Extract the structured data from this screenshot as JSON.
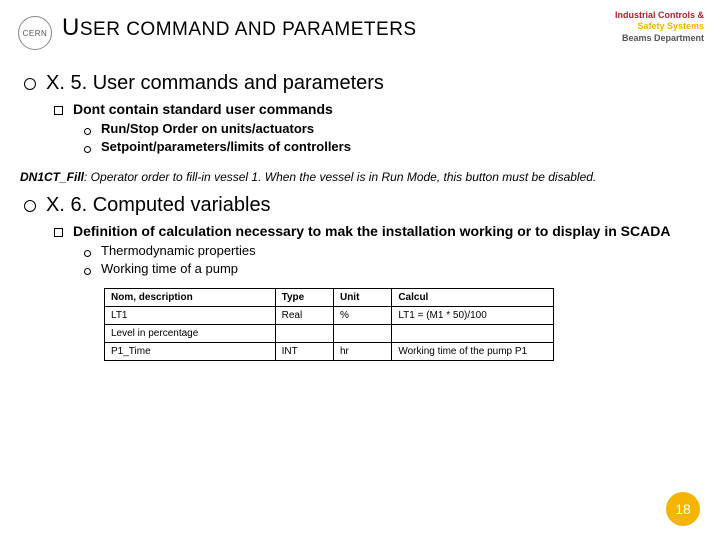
{
  "logo_text": "CERN",
  "dept": {
    "l1": "Industrial Controls &",
    "l2": "Safety Systems",
    "l3": "Beams Department"
  },
  "title_html": "U<span style='font-size:19px'>SER COMMAND AND PARAMETERS</span>",
  "sections": {
    "x5": {
      "heading": "X. 5. User commands and parameters",
      "sub1": "Dont contain standard user commands",
      "bul1": "Run/Stop Order on units/actuators",
      "bul2": "Setpoint/parameters/limits of controllers"
    },
    "note_key": "DN1CT_Fill",
    "note_text": ":  Operator order to fill-in vessel 1. When the vessel is in Run Mode, this button must be disabled.",
    "x6": {
      "heading": "X. 6. Computed variables",
      "sub1": "Definition of calculation necessary to mak the installation working or to display in SCADA",
      "bul1": "Thermodynamic properties",
      "bul2": "Working time of a pump"
    }
  },
  "table": {
    "headers": {
      "c0": "Nom, description",
      "c1": "Type",
      "c2": "Unit",
      "c3": "Calcul"
    },
    "rows": [
      {
        "c0": "LT1",
        "c1": "Real",
        "c2": "%",
        "c3": "LT1 = (M1 * 50)/100"
      },
      {
        "c0": "Level in percentage",
        "c1": "",
        "c2": "",
        "c3": ""
      },
      {
        "c0": "P1_Time",
        "c1": "INT",
        "c2": "hr",
        "c3": "Working time of the pump P1"
      }
    ]
  },
  "page_number": "18"
}
